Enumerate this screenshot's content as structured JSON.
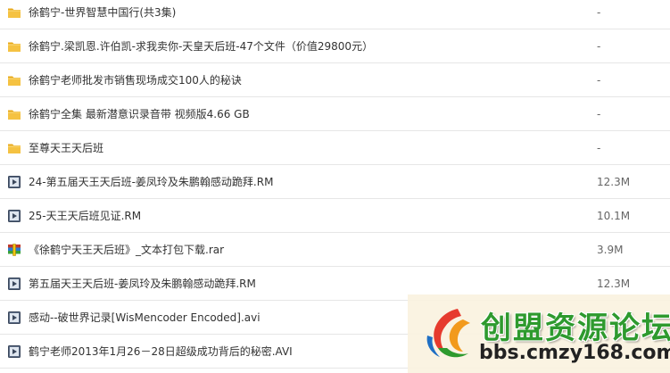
{
  "files": [
    {
      "name": "徐鹤宁-世界智慧中国行(共3集)",
      "size": "-",
      "icon": "folder-icon"
    },
    {
      "name": "徐鹤宁.梁凯恩.许伯凯-求我卖你-天皇天后班-47个文件（价值29800元）",
      "size": "-",
      "icon": "folder-icon"
    },
    {
      "name": "徐鹤宁老师批发市销售现场成交100人的秘诀",
      "size": "-",
      "icon": "folder-icon"
    },
    {
      "name": "徐鹤宁全集 最新潜意识录音带 视频版4.66 GB",
      "size": "-",
      "icon": "folder-icon"
    },
    {
      "name": "至尊天王天后班",
      "size": "-",
      "icon": "folder-icon"
    },
    {
      "name": "24-第五届天王天后班-姜凤玲及朱鹏翰感动跪拜.RM",
      "size": "12.3M",
      "icon": "video-file-icon"
    },
    {
      "name": "25-天王天后班见证.RM",
      "size": "10.1M",
      "icon": "video-file-icon"
    },
    {
      "name": "《徐鹤宁天王天后班》_文本打包下载.rar",
      "size": "3.9M",
      "icon": "archive-file-icon"
    },
    {
      "name": "第五届天王天后班-姜凤玲及朱鹏翰感动跪拜.RM",
      "size": "12.3M",
      "icon": "video-file-icon"
    },
    {
      "name": "感动--破世界记录[WisMencoder Encoded].avi",
      "size": "-",
      "icon": "video-file-icon"
    },
    {
      "name": "鹤宁老师2013年1月26－28日超级成功背后的秘密.AVI",
      "size": "",
      "icon": "video-file-icon"
    }
  ],
  "watermark": {
    "title": "创盟资源论坛",
    "url": "bbs.cmzy168.com",
    "icon": "logo-icon"
  },
  "colors": {
    "folder": "#f5c242",
    "video": "#4a5a72",
    "watermark_green": "#2e9a2e"
  }
}
